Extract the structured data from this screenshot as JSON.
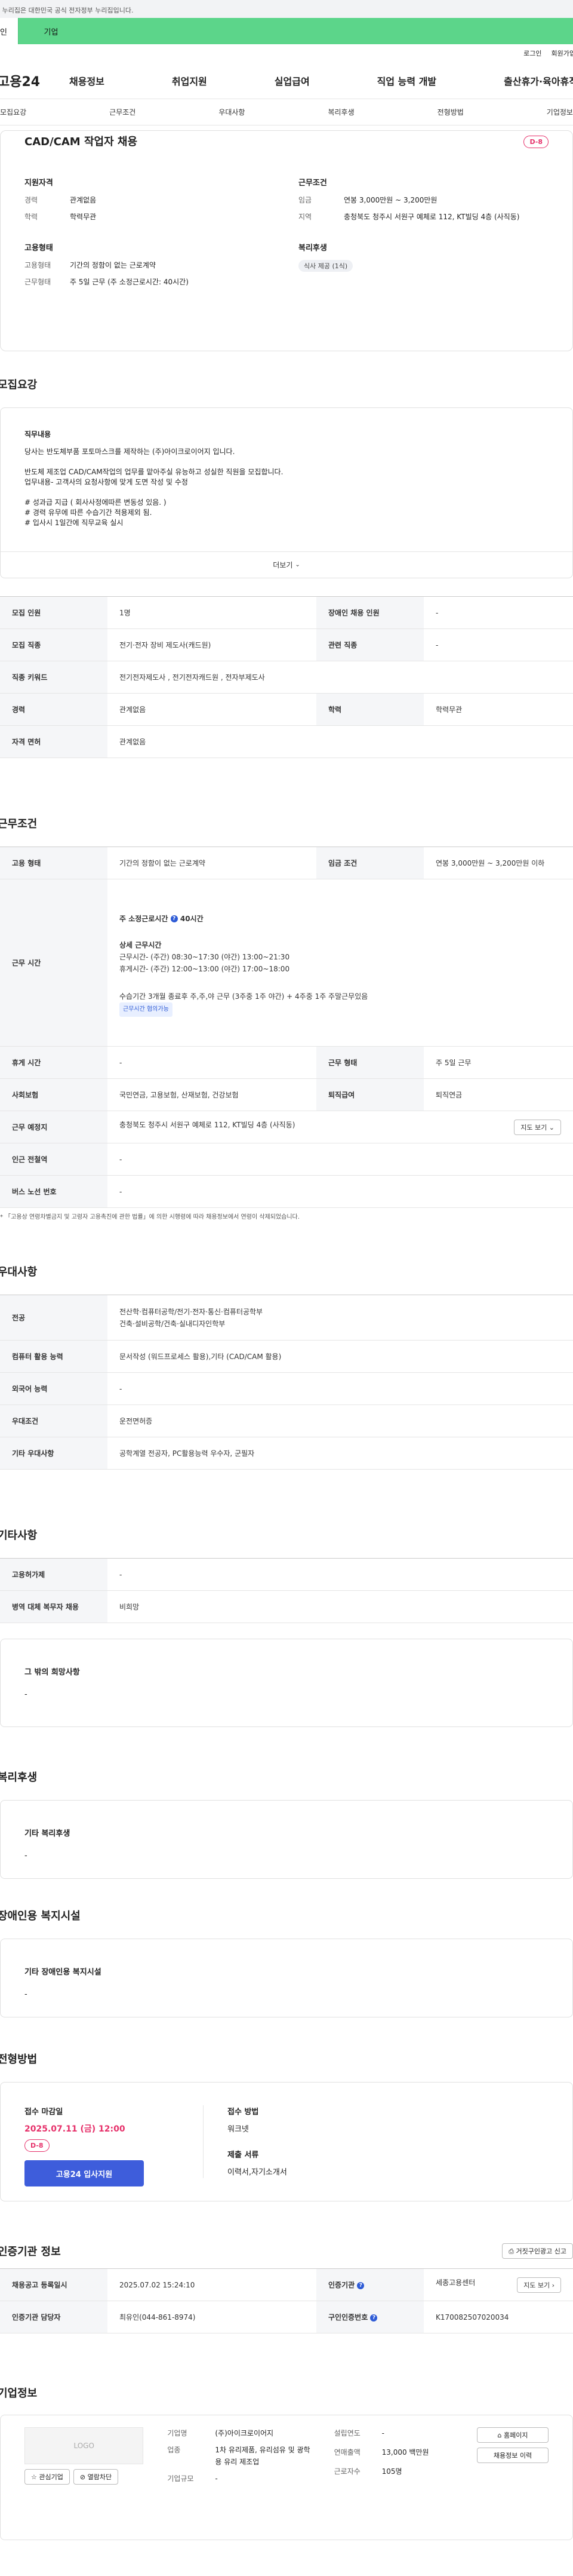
{
  "gov_bar": {
    "text": "이 누리집은 대한민국 공식 전자정부 누리집입니다."
  },
  "user_tabs": [
    {
      "label": "개인"
    },
    {
      "label": "기업"
    }
  ],
  "util_links": [
    {
      "label": "로그인"
    },
    {
      "label": "회원가입"
    }
  ],
  "logo": "고용24",
  "gnb": [
    {
      "label": "채용정보"
    },
    {
      "label": "취업지원"
    },
    {
      "label": "실업급여"
    },
    {
      "label": "직업 능력 개발"
    },
    {
      "label": "출산휴가·육아휴직"
    }
  ],
  "anchor_nav": [
    {
      "label": "모집요강"
    },
    {
      "label": "근무조건"
    },
    {
      "label": "우대사항"
    },
    {
      "label": "복리후생"
    },
    {
      "label": "전형방법"
    },
    {
      "label": "기업정보"
    }
  ],
  "summary": {
    "title": "CAD/CAM 작업자 채용",
    "dday": "D-8",
    "qualification_title": "지원자격",
    "career_key": "경력",
    "career_val": "관계없음",
    "edu_key": "학력",
    "edu_val": "학력무관",
    "emp_title": "고용형태",
    "emp_type_key": "고용형태",
    "emp_type_val": "기간의 정함이 없는 근로계약",
    "work_form_key": "근무형태",
    "work_form_val": "주 5일 근무 (주 소정근로시간: 40시간)",
    "cond_title": "근무조건",
    "wage_key": "임금",
    "wage_val": "연봉 3,000만원 ~ 3,200만원",
    "region_key": "지역",
    "region_val": "충청북도 청주시 서원구 예체로 112, KT빌딩 4층 (사직동)",
    "welfare_title": "복리후생",
    "welfare_chip": "식사 제공 (1식)"
  },
  "recruit": {
    "section_title": "모집요강",
    "detail_title": "직무내용",
    "detail_lines": [
      "당사는 반도체부품 포토마스크를 제작하는 (주)아이크로이어지 입니다.",
      "",
      "반도체 제조업 CAD/CAM작업의 업무를 맡아주실 유능하고 성실한 직원을 모집합니다.",
      "업무내용- 고객사의 요청사항에 맞게 도면 작성 및 수정",
      "",
      "# 성과급 지급 ( 회사사정에따른 변동성 있음. )",
      "# 경력 유무에 따른 수습기간 적용제외 됨.",
      "# 입사시 1일간에 직무교육 실시"
    ],
    "more_label": "더보기",
    "rows": {
      "count_label": "모집 인원",
      "count_val": "1명",
      "disabled_label": "장애인 채용 인원",
      "disabled_val": "-",
      "job_label": "모집 직종",
      "job_val": "전기·전자 장비 제도사(캐드원)",
      "related_label": "관련 직종",
      "related_val": "-",
      "keyword_label": "직종 키워드",
      "keyword_val": "전기전자제도사 , 전기전자캐드원 , 전자부제도사",
      "career_label": "경력",
      "career_val": "관계없음",
      "edu_label": "학력",
      "edu_val": "학력무관",
      "license_label": "자격 면허",
      "license_val": "관계없음"
    }
  },
  "work": {
    "section_title": "근무조건",
    "emp_label": "고용 형태",
    "emp_val": "기간의 정함이 없는 근로계약",
    "wage_label": "임금 조건",
    "wage_val": "연봉 3,000만원 ~ 3,200만원 이하",
    "hours_label": "근무 시간",
    "hours_week": "주 소정근로시간",
    "hours_week_val": "40시간",
    "hours_detail_title": "상세 근무시간",
    "hours_line1": "근무시간- (주간) 08:30~17:30 (야간) 13:00~21:30",
    "hours_line2": "휴게시간- (주간) 12:00~13:00 (야간) 17:00~18:00",
    "hours_line3": "수습기간 3개월 종료후 주,주,야 근무 (3주중 1주 야간) + 4주중 1주 주말근무있음",
    "hours_chip": "근무시간 협의가능",
    "holiday_label": "휴게 시간",
    "holiday_val": "-",
    "form_label": "근무 형태",
    "form_val": "주 5일 근무",
    "insurance_label": "사회보험",
    "insurance_val": "국민연금, 고용보험, 산재보험, 건강보험",
    "retire_label": "퇴직급여",
    "retire_val": "퇴직연금",
    "place_label": "근무 예정지",
    "place_val": "충청북도 청주시 서원구 예체로 112, KT빌딩 4층 (사직동)",
    "map_btn": "지도 보기",
    "station_label": "인근 전철역",
    "station_val": "-",
    "bus_label": "버스 노선 번호",
    "bus_val": "-",
    "note": "* 「고용상 연령차별금지 및 고령자 고용촉진에 관한 법률」에 의한 시행령에 따라 채용정보에서 연령이 삭제되었습니다."
  },
  "pref": {
    "section_title": "우대사항",
    "major_label": "전공",
    "major_val1": "전산학·컴퓨터공학/전기·전자·통신·컴퓨터공학부",
    "major_val2": "건축·설비공학/건축·실내디자인학부",
    "computer_label": "컴퓨터 활용 능력",
    "computer_val": "문서작성 (워드프로세스 활용),기타 (CAD/CAM 활용)",
    "lang_label": "외국어 능력",
    "lang_val": "-",
    "cond_label": "우대조건",
    "cond_val": "운전면허증",
    "etc_label": "기타 우대사항",
    "etc_val": "공학계열 전공자, PC활용능력 우수자, 군필자"
  },
  "other": {
    "section_title": "기타사항",
    "hire_label": "고용허가제",
    "hire_val": "-",
    "military_label": "병역 대체 복무자 채용",
    "military_val": "비희망",
    "wish_title": "그 밖의 희망사항",
    "wish_val": "-"
  },
  "welfare": {
    "section_title": "복리후생",
    "box_title": "기타 복리후생",
    "box_val": "-"
  },
  "disabled": {
    "section_title": "장애인용 복지시설",
    "box_title": "기타 장애인용 복지시설",
    "box_val": "-"
  },
  "selection": {
    "section_title": "전형방법",
    "deadline_title": "접수 마감일",
    "deadline_val": "2025.07.11 (금) 12:00",
    "dday": "D-8",
    "apply_btn": "고용24 입사지원",
    "method_title": "접수 방법",
    "method_val": "워크넷",
    "docs_title": "제출 서류",
    "docs_val": "이력서,자기소개서"
  },
  "agency": {
    "section_title": "인증기관 정보",
    "print_btn": "거짓구인광고 신고",
    "reg_label": "채용공고 등록일시",
    "reg_val": "2025.07.02 15:24:10",
    "agency_label": "인증기관",
    "agency_val": "세종고용센터",
    "map_btn": "지도 보기",
    "manager_label": "인증기관 담당자",
    "manager_val": "최유인(044-861-8974)",
    "num_label": "구인인증번호",
    "num_val": "K170082507020034"
  },
  "company": {
    "section_title": "기업정보",
    "logo_text": "LOGO",
    "fav_btn": "관심기업",
    "block_btn": "열람차단",
    "name_label": "기업명",
    "name_val": "(주)아이크로이어지",
    "industry_label": "업종",
    "industry_val": "1차 유리제품, 유리섬유 및 광학용 유리 제조업",
    "size_label": "기업규모",
    "size_val": "-",
    "founded_label": "설립연도",
    "founded_val": "-",
    "sales_label": "연매출액",
    "sales_val": "13,000 백만원",
    "employees_label": "근로자수",
    "employees_val": "105명",
    "home_btn": "홈페이지",
    "jobs_btn": "채용정보 이력"
  }
}
